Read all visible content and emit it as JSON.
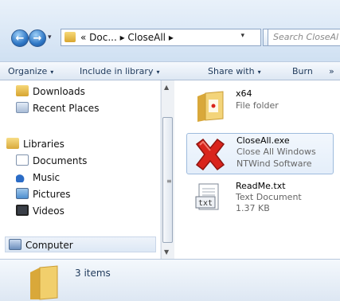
{
  "address": {
    "crumbs": "« Doc... ▸ CloseAll ▸",
    "dropdown": "▾"
  },
  "search": {
    "placeholder": "Search CloseAl"
  },
  "toolbar": {
    "organize": "Organize",
    "include": "Include in library",
    "share": "Share with",
    "burn": "Burn",
    "more": "»",
    "arrow": "▾"
  },
  "nav": {
    "favorites": [
      "Downloads",
      "Recent Places"
    ],
    "libraries": "Libraries",
    "library_items": [
      "Documents",
      "Music",
      "Pictures",
      "Videos"
    ],
    "computer": "Computer"
  },
  "files": [
    {
      "name": "x64",
      "lines": [
        "File folder"
      ],
      "icon": "folder-icon"
    },
    {
      "name": "CloseAll.exe",
      "lines": [
        "Close All Windows",
        "NTWind Software"
      ],
      "icon": "closeall-app-icon"
    },
    {
      "name": "ReadMe.txt",
      "lines": [
        "Text Document",
        "1.37 KB"
      ],
      "icon": "text-file-icon"
    }
  ],
  "status": {
    "count": "3 items"
  },
  "colors": {
    "accent": "#2f78c6",
    "selection": "#e4eefa",
    "folder": "#e8c35a",
    "close_red": "#d9241c"
  }
}
